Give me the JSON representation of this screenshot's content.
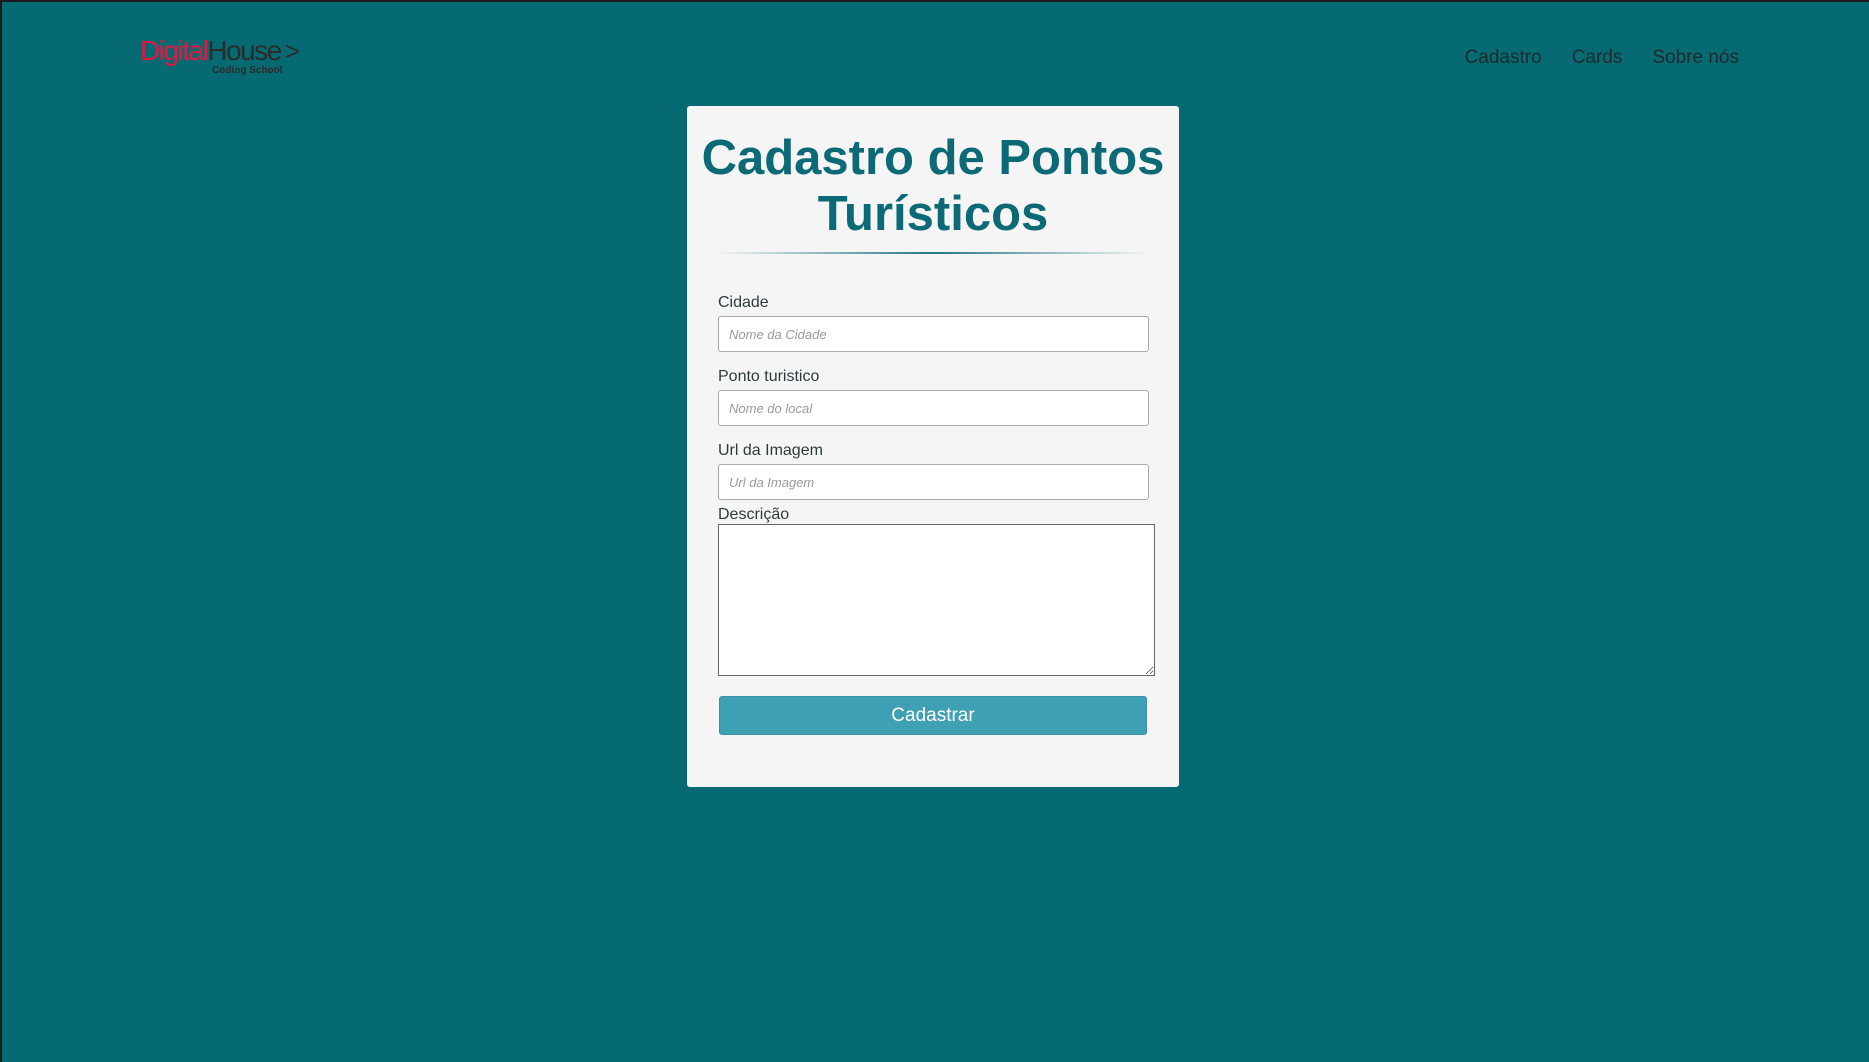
{
  "header": {
    "logo": {
      "digital": "Digital",
      "house": "House",
      "arrow": ">",
      "subtitle": "Coding School"
    },
    "nav": [
      {
        "label": "Cadastro"
      },
      {
        "label": "Cards"
      },
      {
        "label": "Sobre nós"
      }
    ]
  },
  "form": {
    "title": "Cadastro de Pontos Turísticos",
    "fields": {
      "cidade": {
        "label": "Cidade",
        "placeholder": "Nome da Cidade",
        "value": ""
      },
      "ponto": {
        "label": "Ponto turistico",
        "placeholder": "Nome do local",
        "value": ""
      },
      "url": {
        "label": "Url da Imagem",
        "placeholder": "Url da Imagem",
        "value": ""
      },
      "descricao": {
        "label": "Descrição",
        "value": ""
      }
    },
    "submit_label": "Cadastrar"
  },
  "colors": {
    "background": "#066a73",
    "card": "#f5f5f5",
    "title": "#0b6a75",
    "button": "#40a0b3",
    "logo_red": "#e5173f"
  }
}
